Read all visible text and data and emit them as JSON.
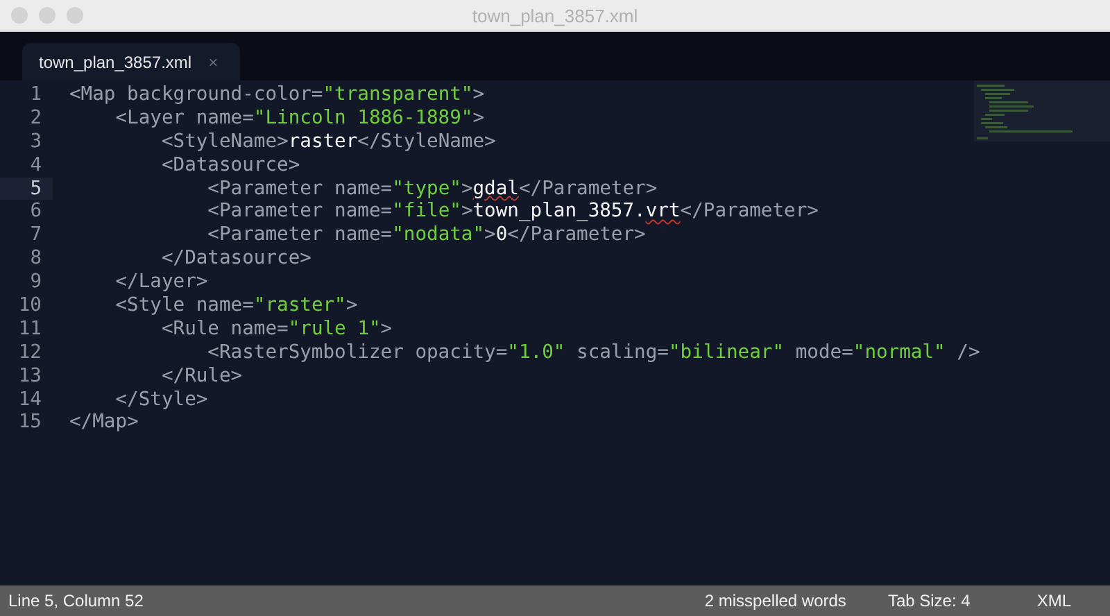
{
  "window": {
    "title": "town_plan_3857.xml"
  },
  "tabs": [
    {
      "label": "town_plan_3857.xml",
      "close": "×",
      "selected": true
    }
  ],
  "editor": {
    "lines": [
      {
        "number": "1",
        "current": false,
        "tokens": [
          {
            "kind": "tag",
            "text": "<Map background-color="
          },
          {
            "kind": "string",
            "text": "\"transparent\""
          },
          {
            "kind": "tag",
            "text": ">"
          }
        ]
      },
      {
        "number": "2",
        "current": false,
        "tokens": [
          {
            "kind": "tag",
            "text": "    <Layer name="
          },
          {
            "kind": "string",
            "text": "\"Lincoln 1886-1889\""
          },
          {
            "kind": "tag",
            "text": ">"
          }
        ]
      },
      {
        "number": "3",
        "current": false,
        "tokens": [
          {
            "kind": "tag",
            "text": "        <StyleName>"
          },
          {
            "kind": "text",
            "text": "raster"
          },
          {
            "kind": "tag",
            "text": "</StyleName>"
          }
        ]
      },
      {
        "number": "4",
        "current": false,
        "tokens": [
          {
            "kind": "tag",
            "text": "        <Datasource>"
          }
        ]
      },
      {
        "number": "5",
        "current": true,
        "tokens": [
          {
            "kind": "tag",
            "text": "            <Parameter name="
          },
          {
            "kind": "string",
            "text": "\"type\""
          },
          {
            "kind": "tag",
            "text": ">"
          },
          {
            "kind": "text",
            "text": "gdal",
            "misspelled": true
          },
          {
            "kind": "tag",
            "text": "</Parameter>"
          }
        ]
      },
      {
        "number": "6",
        "current": false,
        "tokens": [
          {
            "kind": "tag",
            "text": "            <Parameter name="
          },
          {
            "kind": "string",
            "text": "\"file\""
          },
          {
            "kind": "tag",
            "text": ">"
          },
          {
            "kind": "text",
            "text": "town_plan_3857."
          },
          {
            "kind": "text",
            "text": "vrt",
            "misspelled": true
          },
          {
            "kind": "tag",
            "text": "</Parameter>"
          }
        ]
      },
      {
        "number": "7",
        "current": false,
        "tokens": [
          {
            "kind": "tag",
            "text": "            <Parameter name="
          },
          {
            "kind": "string",
            "text": "\"nodata\""
          },
          {
            "kind": "tag",
            "text": ">"
          },
          {
            "kind": "text",
            "text": "0"
          },
          {
            "kind": "tag",
            "text": "</Parameter>"
          }
        ]
      },
      {
        "number": "8",
        "current": false,
        "tokens": [
          {
            "kind": "tag",
            "text": "        </Datasource>"
          }
        ]
      },
      {
        "number": "9",
        "current": false,
        "tokens": [
          {
            "kind": "tag",
            "text": "    </Layer>"
          }
        ]
      },
      {
        "number": "10",
        "current": false,
        "tokens": [
          {
            "kind": "tag",
            "text": "    <Style name="
          },
          {
            "kind": "string",
            "text": "\"raster\""
          },
          {
            "kind": "tag",
            "text": ">"
          }
        ]
      },
      {
        "number": "11",
        "current": false,
        "tokens": [
          {
            "kind": "tag",
            "text": "        <Rule name="
          },
          {
            "kind": "string",
            "text": "\"rule 1\""
          },
          {
            "kind": "tag",
            "text": ">"
          }
        ]
      },
      {
        "number": "12",
        "current": false,
        "tokens": [
          {
            "kind": "tag",
            "text": "            <RasterSymbolizer opacity="
          },
          {
            "kind": "string",
            "text": "\"1.0\""
          },
          {
            "kind": "tag",
            "text": " scaling="
          },
          {
            "kind": "string",
            "text": "\"bilinear\""
          },
          {
            "kind": "tag",
            "text": " mode="
          },
          {
            "kind": "string",
            "text": "\"normal\""
          },
          {
            "kind": "tag",
            "text": " />"
          }
        ]
      },
      {
        "number": "13",
        "current": false,
        "tokens": [
          {
            "kind": "tag",
            "text": "        </Rule>"
          }
        ]
      },
      {
        "number": "14",
        "current": false,
        "tokens": [
          {
            "kind": "tag",
            "text": "    </Style>"
          }
        ]
      },
      {
        "number": "15",
        "current": false,
        "tokens": [
          {
            "kind": "tag",
            "text": "</Map>"
          }
        ]
      }
    ]
  },
  "status_bar": {
    "position": "Line 5, Column 52",
    "spelling": "2 misspelled words",
    "tab_size": "Tab Size: 4",
    "syntax": "XML"
  }
}
